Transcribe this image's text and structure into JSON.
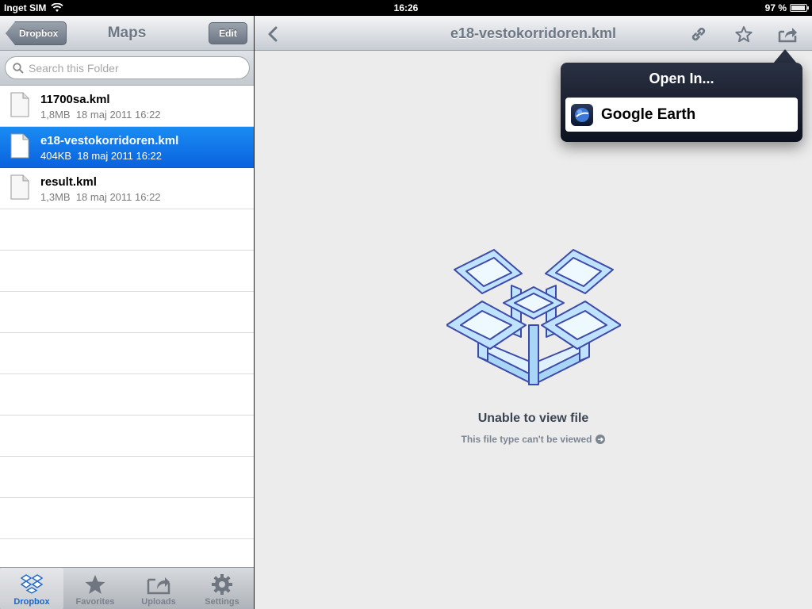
{
  "status": {
    "carrier": "Inget SIM",
    "time": "16:26",
    "battery": "97 %",
    "battery_level": 0.97
  },
  "sidebar": {
    "back_label": "Dropbox",
    "title": "Maps",
    "edit_label": "Edit",
    "search_placeholder": "Search this Folder",
    "files": [
      {
        "name": "11700sa.kml",
        "size": "1,8MB",
        "date": "18 maj 2011 16:22",
        "selected": false
      },
      {
        "name": "e18-vestokorridoren.kml",
        "size": "404KB",
        "date": "18 maj 2011 16:22",
        "selected": true
      },
      {
        "name": "result.kml",
        "size": "1,3MB",
        "date": "18 maj 2011 16:22",
        "selected": false
      }
    ],
    "tabs": [
      {
        "label": "Dropbox",
        "icon": "dropbox-icon",
        "active": true
      },
      {
        "label": "Favorites",
        "icon": "star-icon",
        "active": false
      },
      {
        "label": "Uploads",
        "icon": "upload-icon",
        "active": false
      },
      {
        "label": "Settings",
        "icon": "gear-icon",
        "active": false
      }
    ]
  },
  "viewer": {
    "title": "e18-vestokorridoren.kml",
    "icons": [
      "back-chevron-icon",
      "link-icon",
      "star-icon",
      "share-icon"
    ],
    "message": "Unable to view file",
    "submessage": "This file type can't be viewed"
  },
  "popover": {
    "title": "Open In...",
    "items": [
      {
        "label": "Google Earth",
        "icon": "google-earth-icon"
      }
    ]
  },
  "colors": {
    "selected_row": "#0a62de",
    "active_tab": "#1b66c9",
    "popover_bg": "#0d1220"
  }
}
